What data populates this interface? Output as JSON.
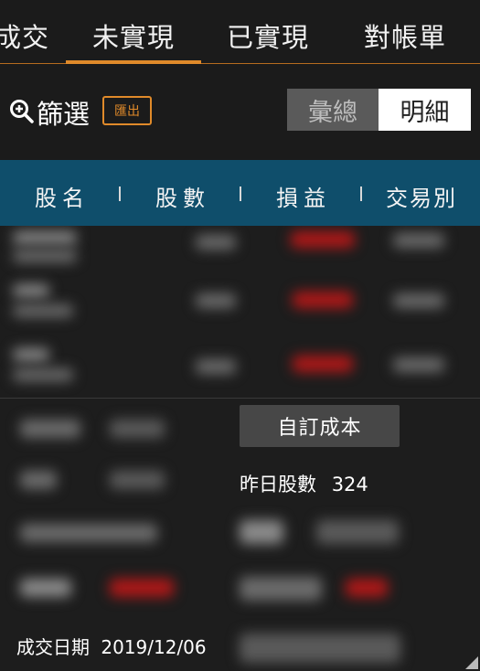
{
  "tabs": [
    {
      "label": "成交"
    },
    {
      "label": "未實現"
    },
    {
      "label": "已實現"
    },
    {
      "label": "對帳單"
    }
  ],
  "filter": {
    "label": "篩選",
    "export_label": "匯出",
    "segment_summary": "彙總",
    "segment_detail": "明細",
    "selected_segment": "明細"
  },
  "columns": [
    "股名",
    "股數",
    "損益",
    "交易別"
  ],
  "detail": {
    "custom_cost_label": "自訂成本",
    "yesterday_shares_label": "昨日股數",
    "yesterday_shares_value": "324",
    "deal_date_label": "成交日期",
    "deal_date_value": "2019/12/06"
  },
  "colors": {
    "accent": "#e08a2a",
    "header_bg": "#0f4e6b",
    "loss_red": "#b01818"
  }
}
